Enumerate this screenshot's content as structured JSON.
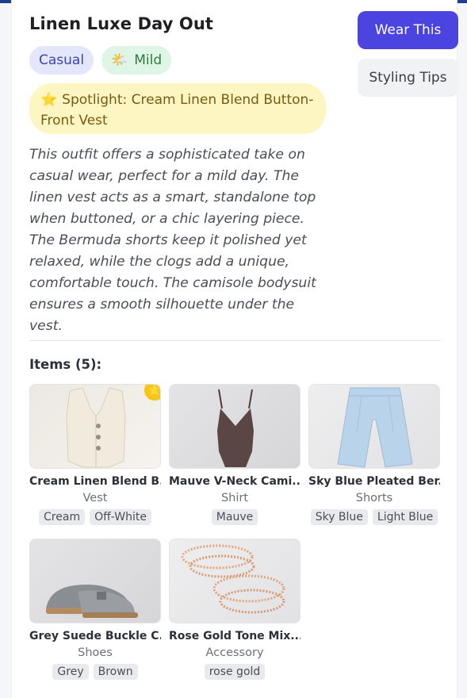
{
  "outfit": {
    "title": "Linen Luxe Day Out",
    "chips": [
      {
        "label": "Casual",
        "emoji": ""
      },
      {
        "label": "Mild",
        "emoji": "🌤️"
      }
    ],
    "spotlight": {
      "star": "⭐",
      "text": "Spotlight: Cream Linen Blend Button-Front Vest"
    },
    "description": "This outfit offers a sophisticated take on casual wear, perfect for a mild day. The linen vest acts as a smart, standalone top when buttoned, or a chic layering piece. The Bermuda shorts keep it polished yet relaxed, while the clogs add a unique, comfortable touch. The camisole bodysuit ensures a smooth silhouette under the vest."
  },
  "actions": {
    "wear_label": "Wear This",
    "tips_label": "Styling Tips"
  },
  "items_heading": "Items (5):",
  "items": [
    {
      "name": "Cream Linen Blend B...",
      "category": "Vest",
      "tags": [
        "Cream",
        "Off-White"
      ],
      "featured": true,
      "badge": "⭐"
    },
    {
      "name": "Mauve V-Neck Cami...",
      "category": "Shirt",
      "tags": [
        "Mauve"
      ],
      "featured": false
    },
    {
      "name": "Sky Blue Pleated Ber...",
      "category": "Shorts",
      "tags": [
        "Sky Blue",
        "Light Blue"
      ],
      "featured": false
    },
    {
      "name": "Grey Suede Buckle C...",
      "category": "Shoes",
      "tags": [
        "Grey",
        "Brown"
      ],
      "featured": false
    },
    {
      "name": "Rose Gold Tone Mix...",
      "category": "Accessory",
      "tags": [
        "rose gold"
      ],
      "featured": false
    }
  ],
  "colors": {
    "primary": "#4c44e0",
    "topbar": "#1f3f8c",
    "spotlight_bg": "#fdf6c3",
    "casual_chip": "#e4e7fb",
    "mild_chip": "#dff6e6"
  }
}
